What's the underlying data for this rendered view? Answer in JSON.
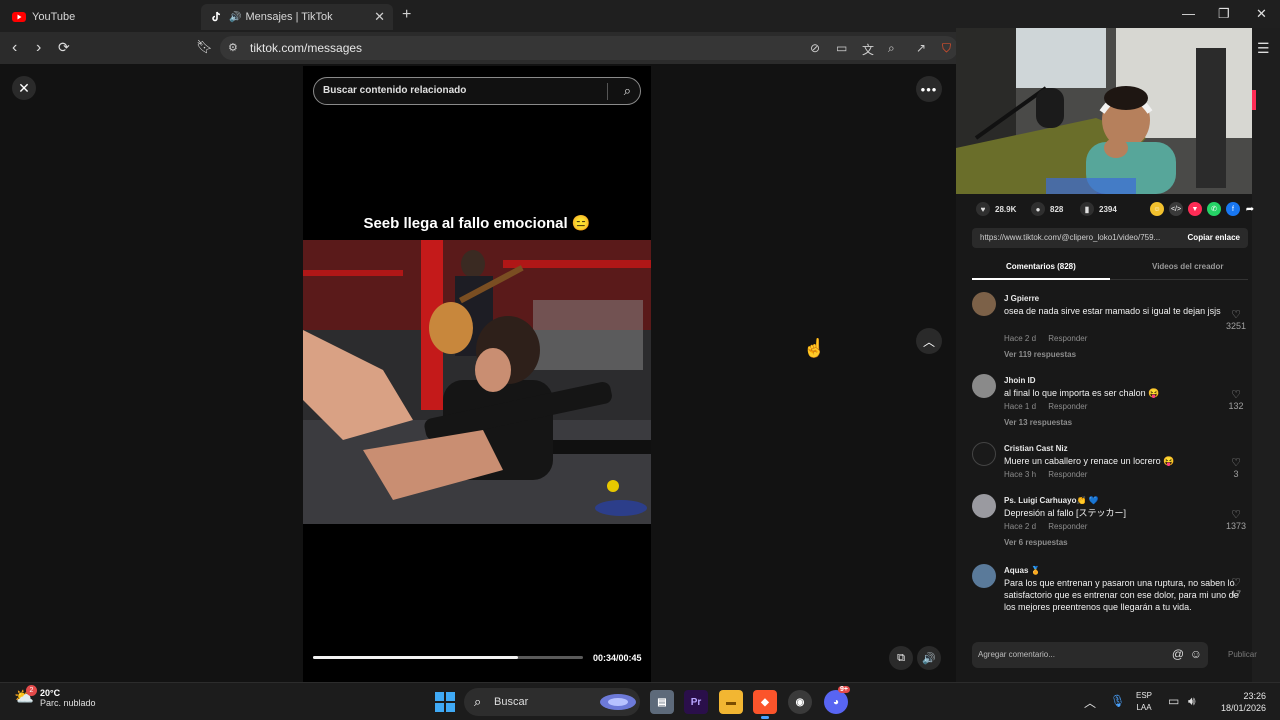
{
  "browser": {
    "tabs": [
      {
        "title": "YouTube",
        "active": false
      },
      {
        "title": "Mensajes | TikTok",
        "active": true
      }
    ],
    "url": "tiktok.com/messages"
  },
  "video": {
    "search_placeholder": "Buscar contenido relacionado",
    "caption": "Seeb llega al fallo emocional 😑",
    "time": "00:34/00:45",
    "progress_fraction": 0.76
  },
  "stats": {
    "likes": "28.9K",
    "comments": "828",
    "saves": "2394"
  },
  "share_link": {
    "url": "https://www.tiktok.com/@clipero_loko1/video/759...",
    "copy_label": "Copiar enlace"
  },
  "comment_tabs": {
    "comments_label": "Comentarios (828)",
    "creator_videos_label": "Videos del creador"
  },
  "comments": [
    {
      "user": "J Gpierre",
      "text": "osea de nada sirve estar mamado si igual te dejan jsjs",
      "age": "Hace 2 d",
      "reply": "Responder",
      "likes": "3251",
      "replies": "Ver 119 respuestas"
    },
    {
      "user": "Jhoin ID",
      "text": "al final lo que importa es ser chalon 😝",
      "age": "Hace 1 d",
      "reply": "Responder",
      "likes": "132",
      "replies": "Ver 13 respuestas"
    },
    {
      "user": "Cristian Cast Niz",
      "text": "Muere un caballero y renace un locrero 😝",
      "age": "Hace 3 h",
      "reply": "Responder",
      "likes": "3",
      "replies": ""
    },
    {
      "user": "Ps. Luigi Carhuayo👏 💙",
      "text": "Depresión al fallo [ステッカー]",
      "age": "Hace 2 d",
      "reply": "Responder",
      "likes": "1373",
      "replies": "Ver 6 respuestas"
    },
    {
      "user": "Aquas 🏅",
      "text": "Para los que entrenan y pasaron una ruptura, no saben lo satisfactorio que es entrenar con ese dolor, para mi uno de los mejores preentrenos que llegarán a tu vida.",
      "age": "",
      "reply": "",
      "likes": "17",
      "replies": ""
    }
  ],
  "comment_input": {
    "placeholder": "Agregar comentario...",
    "publish_label": "Publicar"
  },
  "taskbar": {
    "weather_temp": "20°C",
    "weather_cond": "Parc. nublado",
    "weather_badge": "2",
    "search_label": "Buscar",
    "lang_top": "ESP",
    "lang_bottom": "LAA",
    "time": "23:26",
    "date": "18/01/2026",
    "discord_badge": "9+"
  },
  "colors": {
    "tiktok_red": "#fe2c55",
    "accent_blue": "#4aa3ff"
  }
}
